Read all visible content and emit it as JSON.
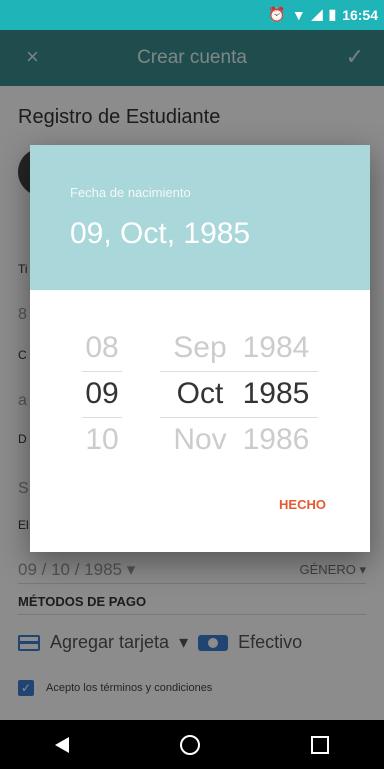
{
  "status": {
    "time": "16:54"
  },
  "toolbar": {
    "title": "Crear cuenta",
    "close_icon": "×",
    "done_icon": "✓"
  },
  "form": {
    "section_title": "Registro de Estudiante",
    "date_value": "09 / 10 / 1985",
    "gender_label": "GÉNERO",
    "payment_label": "MÉTODOS DE PAGO",
    "add_card_label": "Agregar tarjeta",
    "cash_label": "Efectivo",
    "terms_label": "Acepto los términos y condiciones",
    "fragments": [
      "Ti",
      "8",
      "C",
      "a",
      "D",
      "S",
      "El"
    ]
  },
  "dialog": {
    "label": "Fecha de nacimiento",
    "selected_date": "09, Oct, 1985",
    "days": [
      "08",
      "09",
      "10"
    ],
    "months": [
      "Sep",
      "Oct",
      "Nov"
    ],
    "years": [
      "1984",
      "1985",
      "1986"
    ],
    "done_label": "HECHO"
  }
}
